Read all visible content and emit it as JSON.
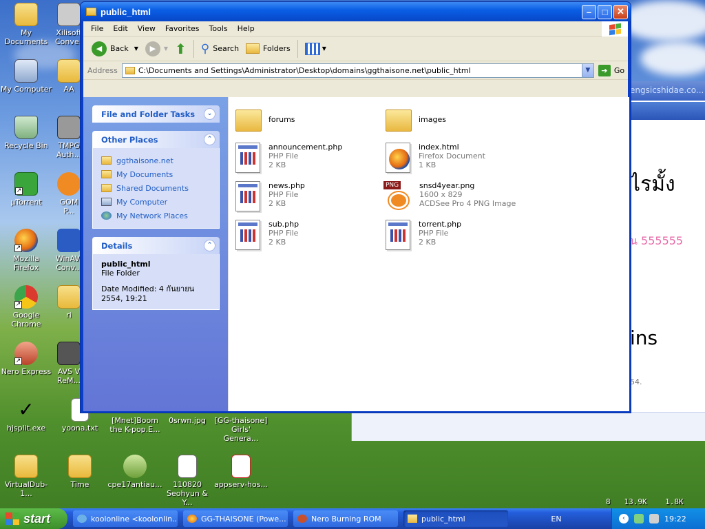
{
  "desktop": {
    "icons": [
      {
        "label": "My Documents"
      },
      {
        "label": "My Computer"
      },
      {
        "label": "Recycle Bin"
      },
      {
        "label": "µTorrent"
      },
      {
        "label": "Mozilla Firefox"
      },
      {
        "label": "Google Chrome"
      },
      {
        "label": "Nero Express"
      },
      {
        "label": "hjsplit.exe"
      },
      {
        "label": "VirtualDub-1..."
      },
      {
        "label": "Xilisoft Conve..."
      },
      {
        "label": "AA"
      },
      {
        "label": "TMPG Auth..."
      },
      {
        "label": "GOM P..."
      },
      {
        "label": "WinAVI Conv..."
      },
      {
        "label": "ri"
      },
      {
        "label": "AVS V ReM..."
      },
      {
        "label": "yoona.txt"
      },
      {
        "label": "Time"
      },
      {
        "label": "[Mnet]Boom the K-pop.E..."
      },
      {
        "label": "cpe17antiau..."
      },
      {
        "label": "0srwn.jpg"
      },
      {
        "label": "110820 Seohyun & Y..."
      },
      {
        "label": "[GG-thaisone] Girls' Genera..."
      },
      {
        "label": "appserv-hos..."
      }
    ]
  },
  "background_window": {
    "url_fragment": "engsicshidae.co...",
    "text_thai": "ไรมั้ง",
    "text_pink": "น 555555",
    "text_ins": "ins",
    "text_small": "54."
  },
  "window": {
    "title": "public_html",
    "menu": [
      "File",
      "Edit",
      "View",
      "Favorites",
      "Tools",
      "Help"
    ],
    "toolbar": {
      "back": "Back",
      "search": "Search",
      "folders": "Folders"
    },
    "address": {
      "label": "Address",
      "path": "C:\\Documents and Settings\\Administrator\\Desktop\\domains\\ggthaisone.net\\public_html",
      "go": "Go"
    },
    "tasks_panel": {
      "title": "File and Folder Tasks"
    },
    "other_places": {
      "title": "Other Places",
      "links": [
        "ggthaisone.net",
        "My Documents",
        "Shared Documents",
        "My Computer",
        "My Network Places"
      ]
    },
    "details": {
      "title": "Details",
      "name": "public_html",
      "type": "File Folder",
      "modified": "Date Modified: 4 กันยายน 2554, 19:21"
    },
    "files": [
      {
        "name": "forums",
        "kind": "folder"
      },
      {
        "name": "images",
        "kind": "folder"
      },
      {
        "name": "announcement.php",
        "type": "PHP File",
        "size": "2 KB",
        "kind": "php"
      },
      {
        "name": "index.html",
        "type": "Firefox Document",
        "size": "1 KB",
        "kind": "html"
      },
      {
        "name": "news.php",
        "type": "PHP File",
        "size": "2 KB",
        "kind": "php"
      },
      {
        "name": "snsd4year.png",
        "type": "1600 x 829",
        "size": "ACDSee Pro 4 PNG Image",
        "kind": "png",
        "tag": "PNG"
      },
      {
        "name": "sub.php",
        "type": "PHP File",
        "size": "2 KB",
        "kind": "php"
      },
      {
        "name": "torrent.php",
        "type": "PHP File",
        "size": "2 KB",
        "kind": "php"
      }
    ]
  },
  "sysinfo": {
    "count": "8",
    "down": "13.9K",
    "up": "1.8K"
  },
  "taskbar": {
    "start": "start",
    "tasks": [
      "koolonline <koolonlin...",
      "GG-THAISONE (Powe...",
      "Nero Burning ROM",
      "public_html"
    ],
    "lang": "EN",
    "clock": "19:22"
  },
  "colors": {
    "xp_blue": "#0a5fe5",
    "panel_link": "#215dc6",
    "start_green": "#3c8f2a"
  }
}
